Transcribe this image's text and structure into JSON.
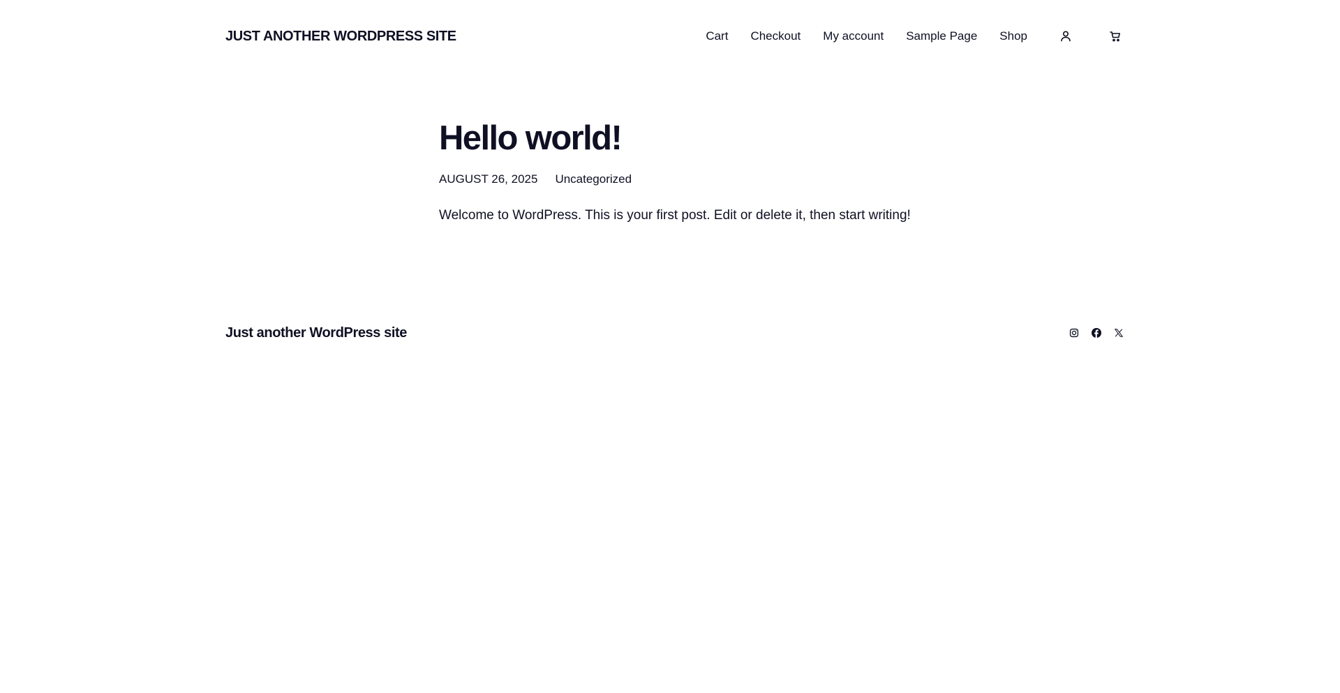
{
  "header": {
    "site_title": "JUST ANOTHER WORDPRESS SITE",
    "nav": [
      {
        "label": "Cart"
      },
      {
        "label": "Checkout"
      },
      {
        "label": "My account"
      },
      {
        "label": "Sample Page"
      },
      {
        "label": "Shop"
      }
    ],
    "icons": {
      "account": "user-account-icon",
      "cart": "shopping-cart-icon"
    }
  },
  "post": {
    "title": "Hello world!",
    "date": "AUGUST 26, 2025",
    "category": "Uncategorized",
    "body": "Welcome to WordPress. This is your first post. Edit or delete it, then start writing!"
  },
  "footer": {
    "site_title": "Just another WordPress site",
    "social": [
      "instagram-icon",
      "facebook-icon",
      "x-icon"
    ]
  },
  "colors": {
    "text": "#0f1023",
    "background": "#ffffff"
  }
}
